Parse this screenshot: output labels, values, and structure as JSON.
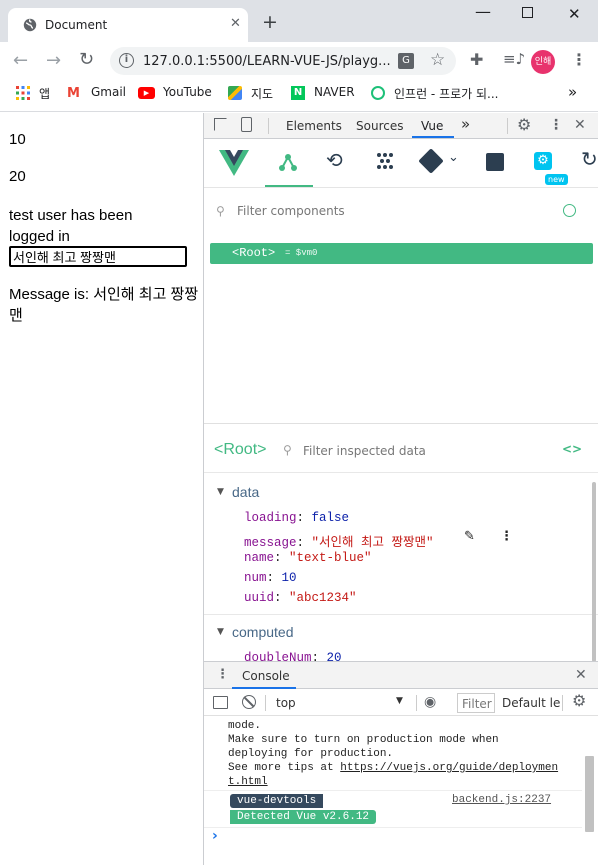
{
  "browser": {
    "tab_title": "Document",
    "url": "127.0.0.1:5500/LEARN-VUE-JS/playg...",
    "profile_label": "인해",
    "bookmarks": [
      "앱",
      "Gmail",
      "YouTube",
      "지도",
      "NAVER",
      "인프런 - 프로가 되..."
    ],
    "bookmarks_more": "»"
  },
  "page": {
    "num": "10",
    "double_num": "20",
    "login_text": "test user has been logged in",
    "input_value": "서인해 최고 짱짱맨",
    "message_text": "Message is: 서인해 최고 짱짱맨"
  },
  "devtools": {
    "tabs": [
      "Elements",
      "Sources",
      "Vue"
    ],
    "active_tab": "Vue",
    "more": "»",
    "vue": {
      "new_badge": "new",
      "filter_components_placeholder": "Filter components",
      "root_label": "<Root>",
      "root_vm": "= $vm0",
      "inspected_title": "<Root>",
      "filter_inspected_placeholder": "Filter inspected data",
      "data_section": "data",
      "data": [
        {
          "key": "loading",
          "value": "false",
          "kind": "keyword"
        },
        {
          "key": "message",
          "value": "\"서인해 최고 짱짱맨\"",
          "kind": "string"
        },
        {
          "key": "name",
          "value": "\"text-blue\"",
          "kind": "string"
        },
        {
          "key": "num",
          "value": "10",
          "kind": "number"
        },
        {
          "key": "uuid",
          "value": "\"abc1234\"",
          "kind": "string"
        }
      ],
      "computed_section": "computed",
      "computed": [
        {
          "key": "doubleNum",
          "value": "20"
        }
      ]
    },
    "console": {
      "drawer_tab": "Console",
      "context": "top",
      "filter_placeholder": "Filter",
      "levels": "Default le",
      "lines": [
        "mode.",
        "Make sure to turn on production mode when",
        "deploying for production.",
        "See more tips at "
      ],
      "link_text_1": "https://vuejs.org/guide/deploymen",
      "link_text_2": "t.html",
      "badge_1": "vue-devtools",
      "badge_2": "Detected Vue v2.6.12",
      "source": "backend.js:2237",
      "prompt": "›"
    }
  },
  "colors": {
    "vue_green": "#42b983",
    "vue_dark": "#35495e",
    "keyword_blue": "#0d22aa",
    "string_red": "#c41a16",
    "key_purple": "#881391"
  }
}
